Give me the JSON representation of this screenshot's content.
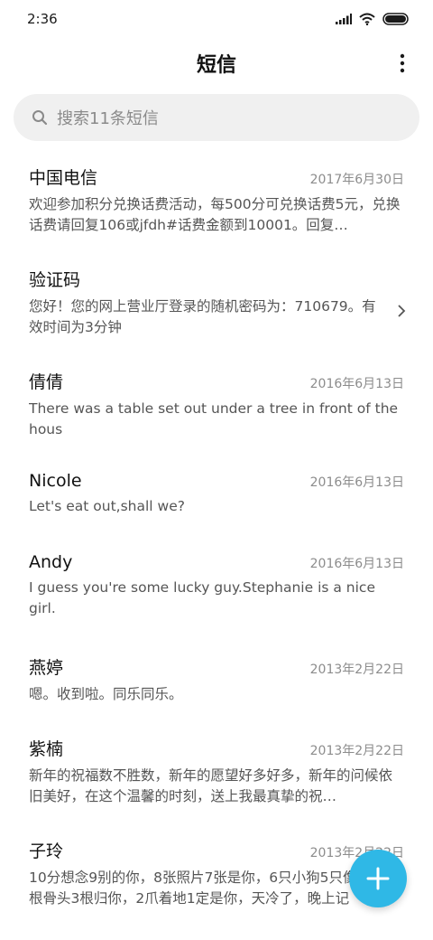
{
  "status_bar": {
    "time": "2:36"
  },
  "app_bar": {
    "title": "短信"
  },
  "search": {
    "placeholder": "搜索11条短信"
  },
  "colors": {
    "fab": "#2fb8e6",
    "search_bg": "#f0f0f0"
  },
  "messages": [
    {
      "name": "中国电信",
      "date": "2017年6月30日",
      "preview": "欢迎参加积分兑换话费活动，每500分可兑换话费5元，兑换话费请回复106或jfdh#话费金额到10001。回复…"
    },
    {
      "name": "验证码",
      "date": "",
      "preview": "您好！您的网上营业厅登录的随机密码为：710679。有效时间为3分钟"
    },
    {
      "name": "倩倩",
      "date": "2016年6月13日",
      "preview": "There was a table set out under a tree in front of the hous"
    },
    {
      "name": "Nicole",
      "date": "2016年6月13日",
      "preview": "Let's eat out,shall we?"
    },
    {
      "name": "Andy",
      "date": "2016年6月13日",
      "preview": "I guess you're some lucky guy.Stephanie is a nice girl."
    },
    {
      "name": "燕婷",
      "date": "2013年2月22日",
      "preview": "嗯。收到啦。同乐同乐。"
    },
    {
      "name": "紫楠",
      "date": "2013年2月22日",
      "preview": "新年的祝福数不胜数，新年的愿望好多好多，新年的问候依旧美好，在这个温馨的时刻，送上我最真挚的祝…"
    },
    {
      "name": "子玲",
      "date": "2013年2月22日",
      "preview": "10分想念9别的你，8张照片7张是你，6只小狗5只像你，4根骨头3根归你，2爪着地1定是你，天冷了，晚上记"
    }
  ]
}
